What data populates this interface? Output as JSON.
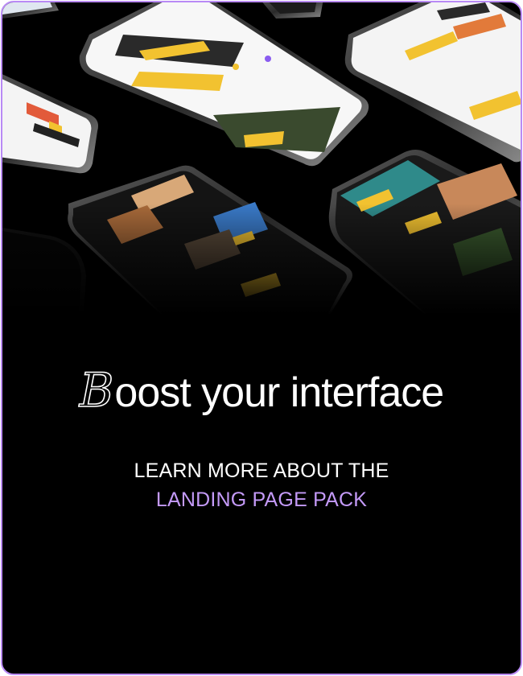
{
  "colors": {
    "accent": "#c49af8",
    "border": "#b98af5",
    "background": "#000000",
    "screen_yellow": "#f2c230"
  },
  "hero": {
    "description": "perspective mockup of several smartphones showing restaurant-booking app screens"
  },
  "headline": {
    "first_letter": "B",
    "rest": "oost your interface"
  },
  "cta": {
    "line1": "LEARN MORE ABOUT THE",
    "line2": "LANDING PAGE PACK"
  }
}
